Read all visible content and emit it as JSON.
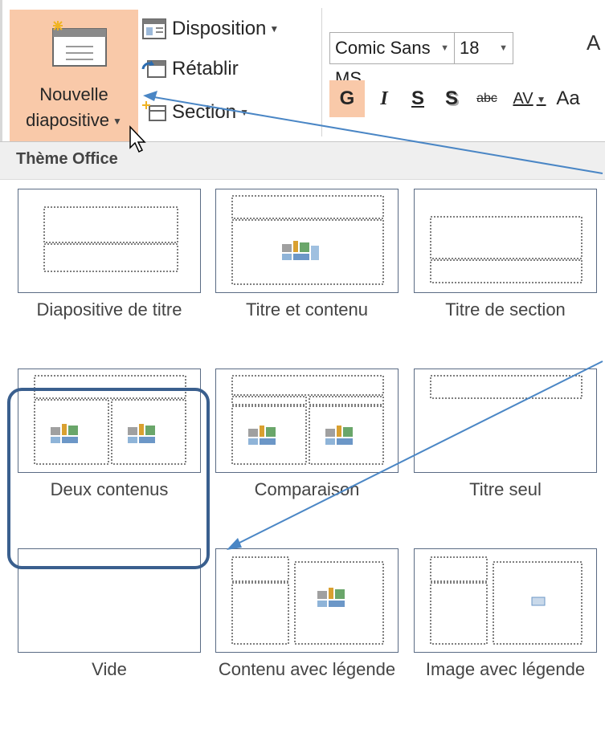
{
  "ribbon": {
    "new_slide": {
      "line1": "Nouvelle",
      "line2": "diapositive"
    },
    "layout_label": "Disposition",
    "reset_label": "Rétablir",
    "section_label": "Section",
    "font_name": "Comic Sans MS",
    "font_size": "18",
    "grow_font": "A",
    "format": {
      "bold": "G",
      "italic": "I",
      "underline": "S",
      "shadow": "S",
      "strike": "abc",
      "spacing": "AV",
      "case": "Aa"
    }
  },
  "dropdown": {
    "header": "Thème Office",
    "layouts": [
      {
        "name": "Diapositive de titre"
      },
      {
        "name": "Titre et contenu"
      },
      {
        "name": "Titre de section"
      },
      {
        "name": "Deux contenus"
      },
      {
        "name": "Comparaison"
      },
      {
        "name": "Titre seul"
      },
      {
        "name": "Vide"
      },
      {
        "name": "Contenu avec légende"
      },
      {
        "name": "Image avec légende"
      }
    ]
  },
  "colors": {
    "highlight": "#f9c9a9",
    "arrow": "#4a86c5",
    "callout": "#3a5f8e"
  }
}
